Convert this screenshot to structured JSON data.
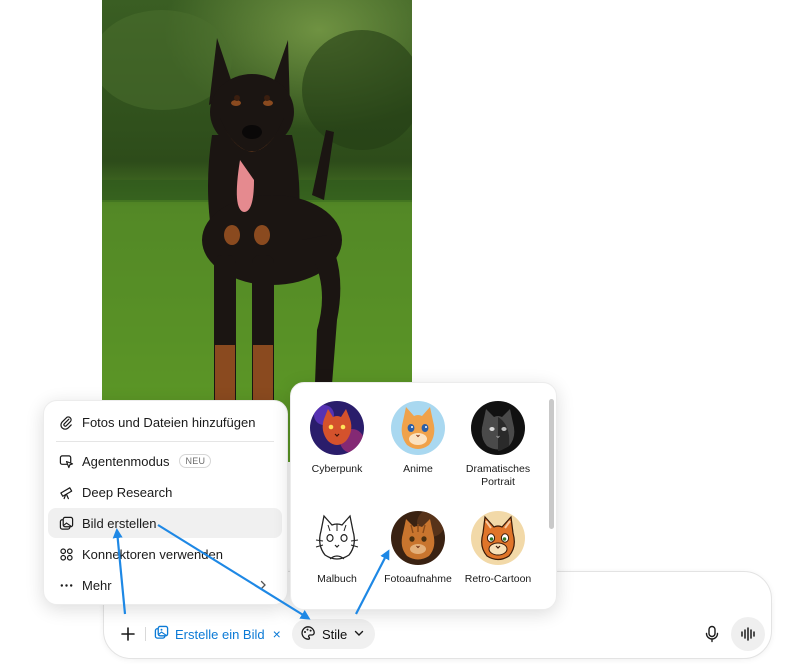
{
  "menu": {
    "items": [
      {
        "label": "Fotos und Dateien hinzufügen",
        "icon": "paperclip-icon"
      },
      {
        "label": "Agentenmodus",
        "icon": "cursor-agent-icon",
        "badge": "NEU"
      },
      {
        "label": "Deep Research",
        "icon": "telescope-icon"
      },
      {
        "label": "Bild erstellen",
        "icon": "image-create-icon",
        "active": true
      },
      {
        "label": "Konnektoren verwenden",
        "icon": "connectors-icon"
      },
      {
        "label": "Mehr",
        "icon": "more-dots-icon",
        "has_submenu": true
      }
    ]
  },
  "styles": {
    "tiles": [
      {
        "label": "Cyberpunk"
      },
      {
        "label": "Anime"
      },
      {
        "label": "Dramatisches Portrait"
      },
      {
        "label": "Malbuch"
      },
      {
        "label": "Fotoaufnahme"
      },
      {
        "label": "Retro-Cartoon"
      }
    ]
  },
  "composer": {
    "tool_chip_label": "Erstelle ein Bild",
    "tool_chip_close": "×",
    "style_button_label": "Stile"
  },
  "colors": {
    "accent": "#0b7ad6",
    "arrow": "#1e88e5",
    "active_item_bg": "#f0f0f0"
  }
}
